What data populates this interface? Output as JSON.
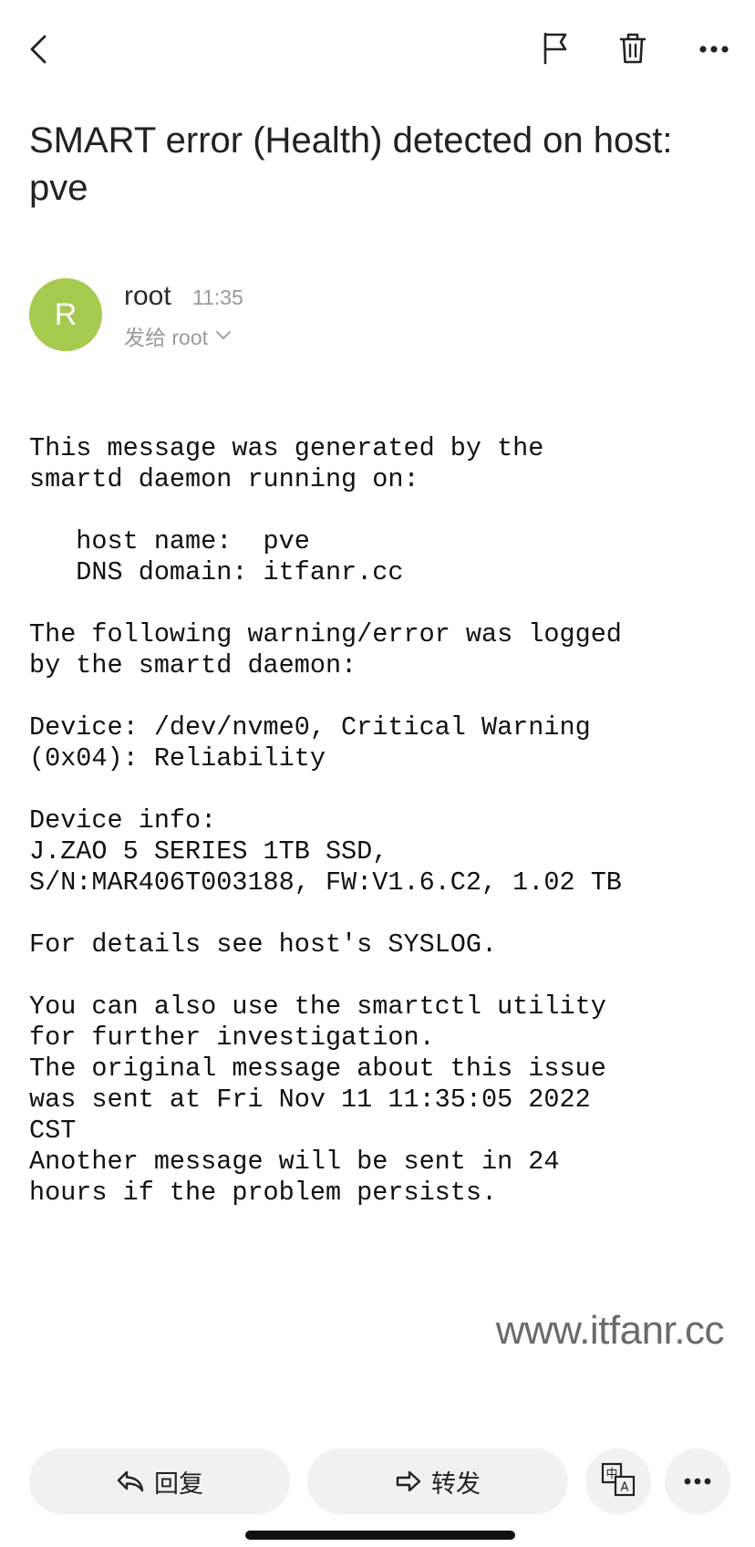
{
  "toolbar": {
    "back_icon": "chevron-left-icon",
    "flag_icon": "flag-icon",
    "trash_icon": "trash-icon",
    "more_icon": "more-horizontal-icon"
  },
  "email": {
    "subject": "SMART error (Health) detected on host: pve",
    "sender": {
      "avatar_letter": "R",
      "avatar_color": "#a6c94f",
      "name": "root",
      "time": "11:35",
      "recipient_line": "发给 root"
    },
    "body": "This message was generated by the\nsmartd daemon running on:\n\n   host name:  pve\n   DNS domain: itfanr.cc\n\nThe following warning/error was logged\nby the smartd daemon:\n\nDevice: /dev/nvme0, Critical Warning\n(0x04): Reliability\n\nDevice info:\nJ.ZAO 5 SERIES 1TB SSD,\nS/N:MAR406T003188, FW:V1.6.C2, 1.02 TB\n\nFor details see host's SYSLOG.\n\nYou can also use the smartctl utility\nfor further investigation.\nThe original message about this issue\nwas sent at Fri Nov 11 11:35:05 2022\nCST\nAnother message will be sent in 24\nhours if the problem persists."
  },
  "watermark": "www.itfanr.cc",
  "actions": {
    "reply_label": "回复",
    "forward_label": "转发",
    "translate_icon": "translate-icon",
    "more_icon": "more-horizontal-icon"
  }
}
